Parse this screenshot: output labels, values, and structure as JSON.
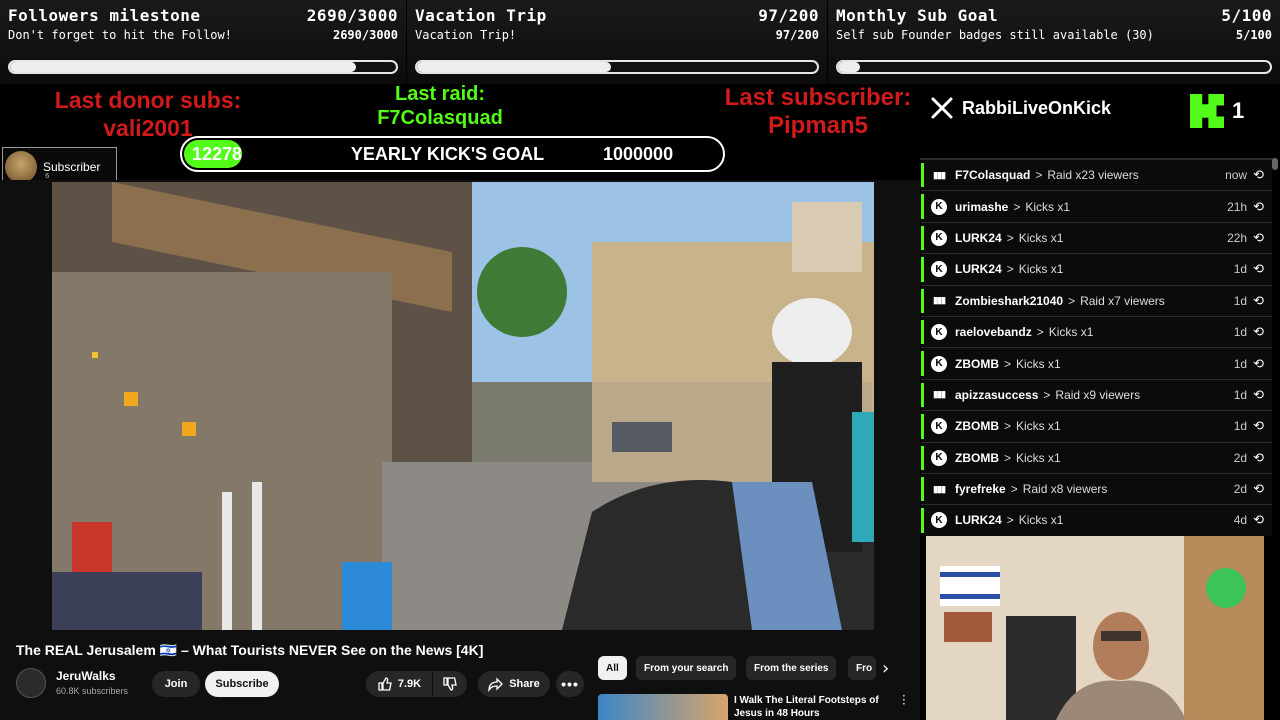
{
  "goals": [
    {
      "title": "Followers milestone",
      "count": "2690/3000",
      "subtitle": "Don't forget to hit the Follow!",
      "progress": 0.897
    },
    {
      "title": "Vacation Trip",
      "count": "97/200",
      "subtitle": "Vacation Trip!",
      "progress": 0.485
    },
    {
      "title": "Monthly Sub Goal",
      "count": "5/100",
      "subtitle": "Self sub Founder badges still available (30)",
      "progress": 0.05
    }
  ],
  "banner": {
    "last_donor_label": "Last donor subs:",
    "last_donor_name": "vali2001",
    "last_raid_label": "Last raid:",
    "last_raid_name": "F7Colasquad",
    "last_sub_label": "Last subscriber:",
    "last_sub_name": "Pipman5",
    "yearly_current": "12278",
    "yearly_title": "YEARLY KICK'S GOAL",
    "yearly_target": "1000000",
    "yearly_progress": 0.0123,
    "x_handle": "RabbiLiveOnKick",
    "kick_count": "1",
    "subscriber_badge": "Subscriber",
    "subscriber_badge_count": "6"
  },
  "youtube": {
    "video_title": "The REAL Jerusalem 🇮🇱 – What Tourists NEVER See on the News [4K]",
    "channel_name": "JeruWalks",
    "channel_subs": "60.8K subscribers",
    "join_label": "Join",
    "subscribe_label": "Subscribe",
    "like_count": "7.9K",
    "share_label": "Share",
    "chips": [
      "All",
      "From your search",
      "From the series",
      "Fro"
    ],
    "rec_title": "I Walk The Literal Footsteps of Jesus in 48 Hours"
  },
  "events": [
    {
      "user": "F7Colasquad",
      "action": "Raid x23 viewers",
      "time": "now",
      "type": "raid"
    },
    {
      "user": "urimashe",
      "action": "Kicks x1",
      "time": "21h",
      "type": "kick"
    },
    {
      "user": "LURK24",
      "action": "Kicks x1",
      "time": "22h",
      "type": "kick"
    },
    {
      "user": "LURK24",
      "action": "Kicks x1",
      "time": "1d",
      "type": "kick"
    },
    {
      "user": "Zombieshark21040",
      "action": "Raid x7 viewers",
      "time": "1d",
      "type": "raid"
    },
    {
      "user": "raelovebandz",
      "action": "Kicks x1",
      "time": "1d",
      "type": "kick"
    },
    {
      "user": "ZBOMB",
      "action": "Kicks x1",
      "time": "1d",
      "type": "kick"
    },
    {
      "user": "apizzasuccess",
      "action": "Raid x9 viewers",
      "time": "1d",
      "type": "raid"
    },
    {
      "user": "ZBOMB",
      "action": "Kicks x1",
      "time": "1d",
      "type": "kick"
    },
    {
      "user": "ZBOMB",
      "action": "Kicks x1",
      "time": "2d",
      "type": "kick"
    },
    {
      "user": "fyrefreke",
      "action": "Raid x8 viewers",
      "time": "2d",
      "type": "raid"
    },
    {
      "user": "LURK24",
      "action": "Kicks x1",
      "time": "4d",
      "type": "kick"
    }
  ],
  "colors": {
    "kick_green": "#53fc18",
    "donor_red": "#d11a1a"
  }
}
